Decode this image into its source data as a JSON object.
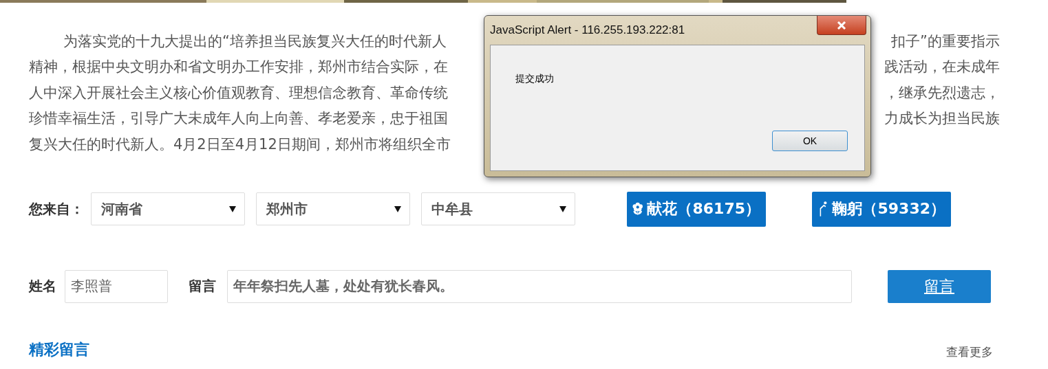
{
  "article": {
    "lines": [
      {
        "indent": true,
        "left": "为落实党的十九大提出的“培养担当民族复兴大任的时代新人",
        "right": "扣子”的重要指示"
      },
      {
        "indent": false,
        "left": "精神，根据中央文明办和省文明办工作安排，郑州市结合实际，在",
        "right": "践活动，在未成年"
      },
      {
        "indent": false,
        "left": "人中深入开展社会主义核心价值观教育、理想信念教育、革命传统",
        "right": "，继承先烈遗志，"
      },
      {
        "indent": false,
        "left": "珍惜幸福生活，引导广大未成年人向上向善、孝老爱亲，忠于祖国",
        "right": "力成长为担当民族"
      },
      {
        "indent": false,
        "left": "复兴大任的时代新人。4月2日至4月12日期间，郑州市将组织全市"
      }
    ]
  },
  "location": {
    "label": "您来自：",
    "selects": [
      {
        "value": "河南省"
      },
      {
        "value": "郑州市"
      },
      {
        "value": "中牟县"
      }
    ]
  },
  "actions": [
    {
      "kind": "flower",
      "label": "献花（86175）"
    },
    {
      "kind": "bow",
      "label": "鞠躬（59332）"
    }
  ],
  "message_form": {
    "name_label": "姓名",
    "name_value": "李照普",
    "message_label": "留言",
    "message_value": "年年祭扫先人墓，处处有犹长春风。",
    "submit": "留言"
  },
  "comments": {
    "title": "精彩留言",
    "more": "查看更多"
  },
  "alert": {
    "title": "JavaScript Alert - 116.255.193.222:81",
    "message": "提交成功",
    "button": "OK"
  }
}
